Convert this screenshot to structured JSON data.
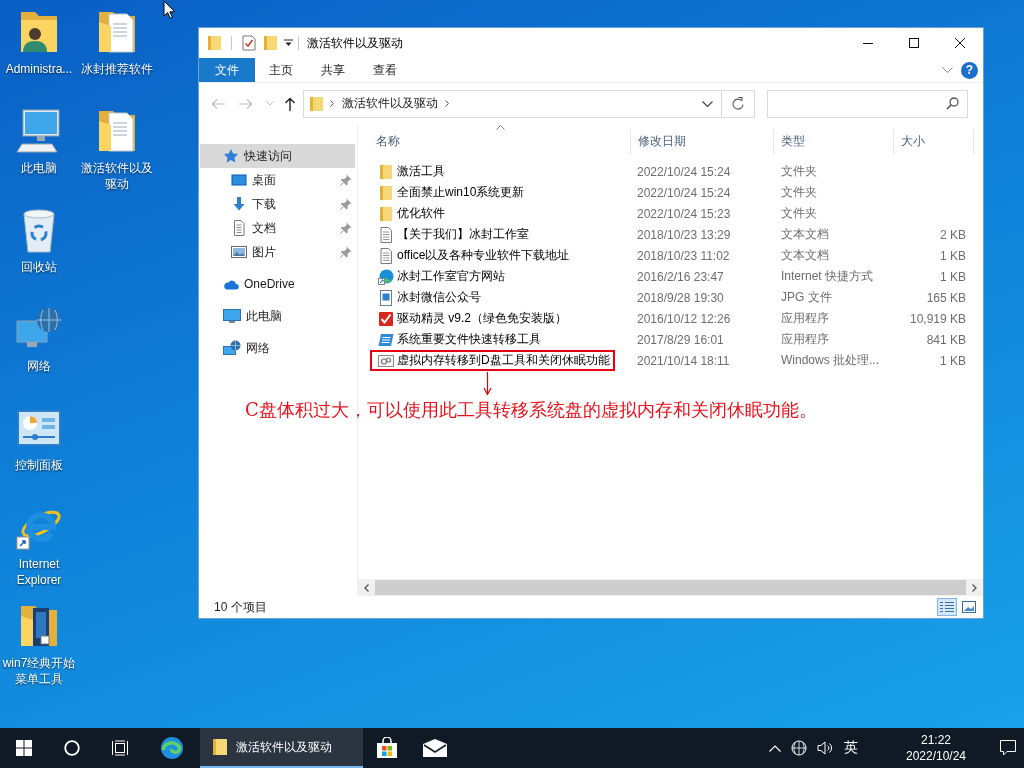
{
  "desktop": {
    "icons": [
      {
        "label": "Administra...",
        "kind": "user-folder"
      },
      {
        "label": "此电脑",
        "kind": "computer"
      },
      {
        "label": "回收站",
        "kind": "recycle-bin"
      },
      {
        "label": "网络",
        "kind": "network"
      },
      {
        "label": "控制面板",
        "kind": "control-panel"
      },
      {
        "label": "Internet Explorer",
        "kind": "browser"
      },
      {
        "label": "win7经典开始菜单工具",
        "kind": "app-folder"
      },
      {
        "label": "冰封推荐软件",
        "kind": "doc-folder"
      },
      {
        "label": "激活软件以及驱动",
        "kind": "doc-folder"
      }
    ]
  },
  "window": {
    "title": "激活软件以及驱动",
    "ribbon_tabs": [
      {
        "label": "文件",
        "kind": "file-menu"
      },
      {
        "label": "主页",
        "kind": "tab"
      },
      {
        "label": "共享",
        "kind": "tab"
      },
      {
        "label": "查看",
        "kind": "tab"
      }
    ],
    "help_button": "?",
    "nav_buttons": [
      {
        "kind": "back",
        "disabled": true
      },
      {
        "kind": "forward",
        "disabled": true
      },
      {
        "kind": "recent",
        "disabled": true
      },
      {
        "kind": "up",
        "disabled": false
      }
    ],
    "address": {
      "path": "激活软件以及驱动"
    },
    "navigation": [
      {
        "label": "快速访问",
        "kind": "quick-access",
        "selected": true,
        "children": [
          {
            "label": "桌面",
            "kind": "desktop",
            "selected": false,
            "pinned": true
          },
          {
            "label": "下载",
            "kind": "downloads",
            "selected": false,
            "pinned": true
          },
          {
            "label": "文档",
            "kind": "documents",
            "selected": false,
            "pinned": true
          },
          {
            "label": "图片",
            "kind": "pictures",
            "selected": false,
            "pinned": true
          }
        ]
      },
      {
        "label": "OneDrive",
        "kind": "cloud",
        "selected": false
      },
      {
        "label": "此电脑",
        "kind": "computer",
        "selected": false
      },
      {
        "label": "网络",
        "kind": "network",
        "selected": false
      }
    ],
    "file_list": {
      "columns": [
        {
          "label": "名称",
          "sorted": true
        },
        {
          "label": "修改日期",
          "sorted": false
        },
        {
          "label": "类型",
          "sorted": false
        },
        {
          "label": "大小",
          "sorted": false
        }
      ],
      "rows": [
        {
          "name": "激活工具",
          "date": "2022/10/24 15:24",
          "type": "文件夹",
          "kind": "folder",
          "boxed": false
        },
        {
          "name": "全面禁止win10系统更新",
          "date": "2022/10/24 15:24",
          "type": "文件夹",
          "kind": "folder",
          "boxed": false
        },
        {
          "name": "优化软件",
          "date": "2022/10/24 15:23",
          "type": "文件夹",
          "kind": "folder",
          "boxed": false
        },
        {
          "name": "【关于我们】冰封工作室",
          "date": "2018/10/23 13:29",
          "type": "文本文档",
          "size": "2 KB",
          "kind": "text",
          "boxed": false
        },
        {
          "name": "office以及各种专业软件下载地址",
          "date": "2018/10/23 11:02",
          "type": "文本文档",
          "size": "1 KB",
          "kind": "text",
          "boxed": false
        },
        {
          "name": "冰封工作室官方网站",
          "date": "2016/2/16 23:47",
          "type": "Internet 快捷方式",
          "size": "1 KB",
          "kind": "shortcut",
          "boxed": false
        },
        {
          "name": "冰封微信公众号",
          "date": "2018/9/28 19:30",
          "type": "JPG 文件",
          "size": "165 KB",
          "kind": "image",
          "boxed": false
        },
        {
          "name": "驱动精灵 v9.2（绿色免安装版）",
          "date": "2016/10/12 12:26",
          "type": "应用程序",
          "size": "10,919 KB",
          "kind": "driver-app",
          "boxed": false
        },
        {
          "name": "系统重要文件快速转移工具",
          "date": "2017/8/29 16:01",
          "type": "应用程序",
          "size": "841 KB",
          "kind": "transfer-app",
          "boxed": false
        },
        {
          "name": "虚拟内存转移到D盘工具和关闭休眠功能",
          "date": "2021/10/14 18:11",
          "type": "Windows 批处理...",
          "size": "1 KB",
          "kind": "batch",
          "boxed": true
        }
      ]
    },
    "annotation": "C盘体积过大，可以使用此工具转移系统盘的虚拟内存和关闭休眠功能。",
    "status_bar": {
      "item_count": "10 个项目",
      "views": [
        {
          "kind": "details",
          "selected": true
        },
        {
          "kind": "large-icons",
          "selected": false
        }
      ]
    }
  },
  "taskbar": {
    "apps": [
      {
        "kind": "edge",
        "active": false
      },
      {
        "kind": "explorer",
        "label": "激活软件以及驱动",
        "active": true
      },
      {
        "kind": "store",
        "active": false
      },
      {
        "kind": "mail",
        "active": false
      }
    ],
    "input_method": "英",
    "clock": {
      "time": "21:22",
      "date": "2022/10/24"
    }
  }
}
